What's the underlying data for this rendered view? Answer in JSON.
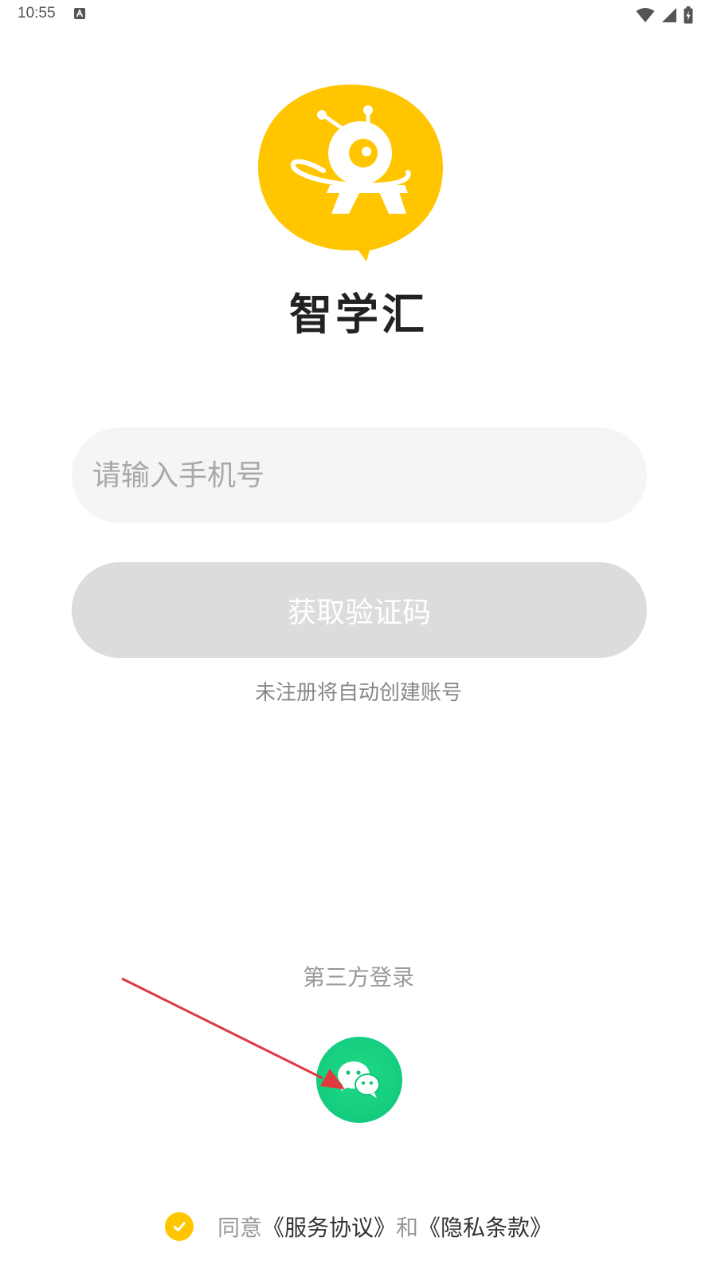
{
  "status_bar": {
    "time": "10:55",
    "icons": [
      "keyboard-a-icon",
      "wifi-icon",
      "signal-icon",
      "battery-charging-icon"
    ]
  },
  "app": {
    "name": "智学汇",
    "brand_color": "#ffc600"
  },
  "login_form": {
    "phone_placeholder": "请输入手机号",
    "phone_value": "",
    "get_code_label": "获取验证码",
    "auto_create_hint": "未注册将自动创建账号"
  },
  "third_party": {
    "title": "第三方登录",
    "wechat_icon": "wechat-icon",
    "wechat_color": "#10c57a"
  },
  "agreement": {
    "checked": true,
    "agree_text": "同意",
    "service_link": "《服务协议》",
    "and_text": "和",
    "privacy_link": "《隐私条款》"
  }
}
